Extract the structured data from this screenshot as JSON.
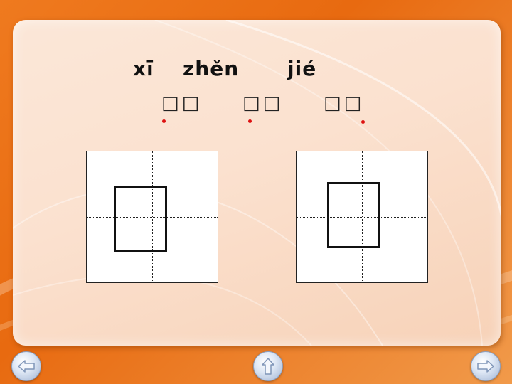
{
  "slide": {
    "pinyin": [
      "xī",
      "zhěn",
      "jié"
    ],
    "hanzi": [
      "□□",
      "□□",
      "□□"
    ]
  },
  "writing_grids": [
    {
      "char_frame": "□"
    },
    {
      "char_frame": "□"
    }
  ],
  "navigation": {
    "prev": "left-arrow-icon",
    "home": "up-arrow-icon",
    "next": "right-arrow-icon"
  },
  "colors": {
    "background": "#e86a10",
    "panel": "#fbe1cf",
    "dot": "#dd1111",
    "ink": "#111111"
  }
}
